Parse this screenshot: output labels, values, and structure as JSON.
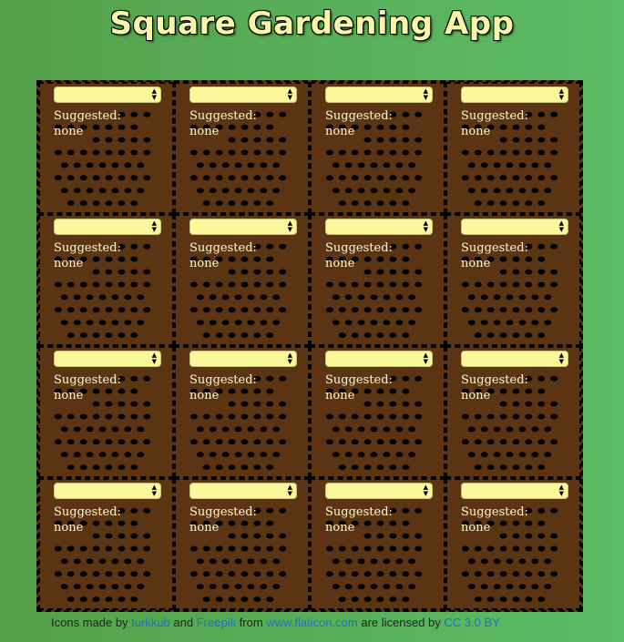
{
  "app": {
    "title": "Square Gardening App"
  },
  "grid": {
    "rows": 4,
    "cols": 4,
    "cells": [
      {
        "selected": "",
        "suggested_label": "Suggested:",
        "suggested_value": "none"
      },
      {
        "selected": "",
        "suggested_label": "Suggested:",
        "suggested_value": "none"
      },
      {
        "selected": "",
        "suggested_label": "Suggested:",
        "suggested_value": "none"
      },
      {
        "selected": "",
        "suggested_label": "Suggested:",
        "suggested_value": "none"
      },
      {
        "selected": "",
        "suggested_label": "Suggested:",
        "suggested_value": "none"
      },
      {
        "selected": "",
        "suggested_label": "Suggested:",
        "suggested_value": "none"
      },
      {
        "selected": "",
        "suggested_label": "Suggested:",
        "suggested_value": "none"
      },
      {
        "selected": "",
        "suggested_label": "Suggested:",
        "suggested_value": "none"
      },
      {
        "selected": "",
        "suggested_label": "Suggested:",
        "suggested_value": "none"
      },
      {
        "selected": "",
        "suggested_label": "Suggested:",
        "suggested_value": "none"
      },
      {
        "selected": "",
        "suggested_label": "Suggested:",
        "suggested_value": "none"
      },
      {
        "selected": "",
        "suggested_label": "Suggested:",
        "suggested_value": "none"
      },
      {
        "selected": "",
        "suggested_label": "Suggested:",
        "suggested_value": "none"
      },
      {
        "selected": "",
        "suggested_label": "Suggested:",
        "suggested_value": "none"
      },
      {
        "selected": "",
        "suggested_label": "Suggested:",
        "suggested_value": "none"
      },
      {
        "selected": "",
        "suggested_label": "Suggested:",
        "suggested_value": "none"
      }
    ]
  },
  "footer": {
    "prefix": "Icons made by ",
    "author1": "turkkub",
    "and": " and ",
    "author2": "Freepik",
    "from": " from ",
    "site": "www.flaticon.com",
    "licensed": " are licensed by ",
    "license": "CC 3.0 BY"
  },
  "colors": {
    "soil": "#5b3414",
    "select_bg": "#fbf89c",
    "title": "#f8f6a8",
    "link": "#1f6fd0"
  },
  "icons": {
    "soil_pattern": "soil-holes-icon",
    "select_arrows": "up-down-arrows-icon"
  }
}
